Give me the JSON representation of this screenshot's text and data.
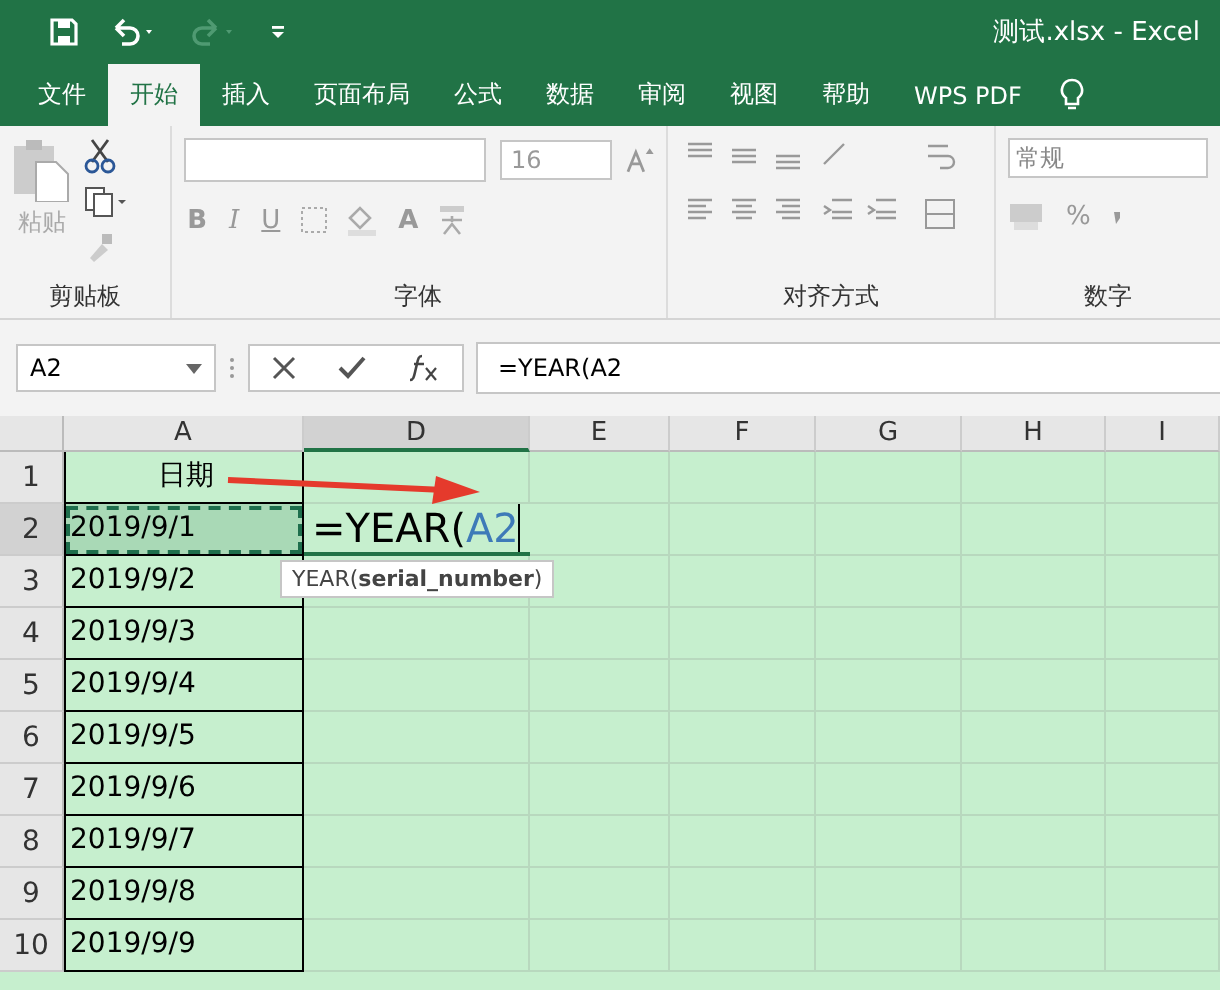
{
  "window": {
    "title": "测试.xlsx  -  Excel"
  },
  "tabs": [
    {
      "label": "文件",
      "selected": false
    },
    {
      "label": "开始",
      "selected": true
    },
    {
      "label": "插入",
      "selected": false
    },
    {
      "label": "页面布局",
      "selected": false
    },
    {
      "label": "公式",
      "selected": false
    },
    {
      "label": "数据",
      "selected": false
    },
    {
      "label": "审阅",
      "selected": false
    },
    {
      "label": "视图",
      "selected": false
    },
    {
      "label": "帮助",
      "selected": false
    },
    {
      "label": "WPS PDF",
      "selected": false
    }
  ],
  "ribbon": {
    "paste_label": "粘贴",
    "font_size": "16",
    "bold": "B",
    "italic": "I",
    "underline": "U",
    "font_color": "A",
    "number_format": "常规",
    "percent": "%",
    "groups": [
      "剪贴板",
      "字体",
      "对齐方式",
      "数字"
    ]
  },
  "formula_bar": {
    "name_box": "A2",
    "formula": "=YEAR(A2"
  },
  "table": {
    "columns": [
      {
        "label": "A",
        "selected": false
      },
      {
        "label": "D",
        "selected": true
      },
      {
        "label": "E",
        "selected": false
      },
      {
        "label": "F",
        "selected": false
      },
      {
        "label": "G",
        "selected": false
      },
      {
        "label": "H",
        "selected": false
      },
      {
        "label": "I",
        "selected": false
      }
    ],
    "rows": [
      {
        "label": "1",
        "selected": false,
        "marquee": false,
        "column_a": "日期"
      },
      {
        "label": "2",
        "selected": true,
        "marquee": true,
        "column_a": "2019/9/1"
      },
      {
        "label": "3",
        "selected": false,
        "marquee": false,
        "column_a": "2019/9/2"
      },
      {
        "label": "4",
        "selected": false,
        "marquee": false,
        "column_a": "2019/9/3"
      },
      {
        "label": "5",
        "selected": false,
        "marquee": false,
        "column_a": "2019/9/4"
      },
      {
        "label": "6",
        "selected": false,
        "marquee": false,
        "column_a": "2019/9/5"
      },
      {
        "label": "7",
        "selected": false,
        "marquee": false,
        "column_a": "2019/9/6"
      },
      {
        "label": "8",
        "selected": false,
        "marquee": false,
        "column_a": "2019/9/7"
      },
      {
        "label": "9",
        "selected": false,
        "marquee": false,
        "column_a": "2019/9/8"
      },
      {
        "label": "10",
        "selected": false,
        "marquee": false,
        "column_a": "2019/9/9"
      }
    ],
    "editor": {
      "text": "=YEAR(",
      "reference": "A2",
      "tooltip": "YEAR(**serial_number**)"
    }
  }
}
